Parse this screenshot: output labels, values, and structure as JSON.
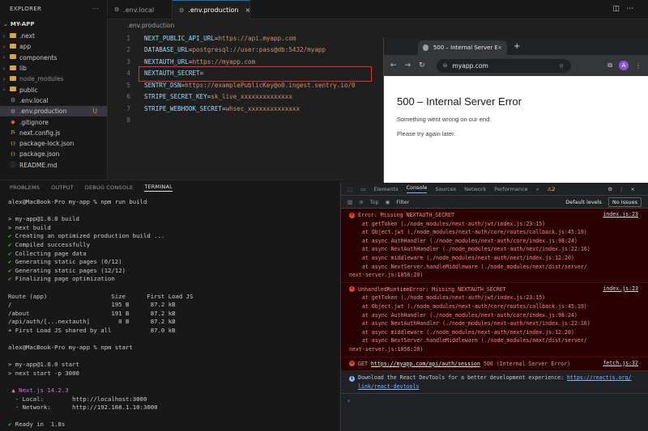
{
  "sidebar": {
    "title": "EXPLORER",
    "more": "···",
    "root": "MY-APP",
    "items": [
      {
        "label": ".next",
        "type": "folder",
        "dim": false,
        "badge": ""
      },
      {
        "label": "app",
        "type": "folder",
        "dim": false,
        "badge": ""
      },
      {
        "label": "components",
        "type": "folder",
        "dim": false,
        "badge": ""
      },
      {
        "label": "lib",
        "type": "folder",
        "dim": false,
        "badge": ""
      },
      {
        "label": "node_modules",
        "type": "folder",
        "dim": true,
        "badge": ""
      },
      {
        "label": "public",
        "type": "folder",
        "dim": false,
        "badge": ""
      },
      {
        "label": ".env.local",
        "type": "env",
        "dim": false,
        "badge": ""
      },
      {
        "label": ".env.production",
        "type": "env",
        "dim": false,
        "badge": "U"
      },
      {
        "label": ".gitignore",
        "type": "git",
        "dim": false,
        "badge": ""
      },
      {
        "label": "next.config.js",
        "type": "js",
        "dim": false,
        "badge": ""
      },
      {
        "label": "package-lock.json",
        "type": "json",
        "dim": false,
        "badge": ""
      },
      {
        "label": "package.json",
        "type": "json",
        "dim": false,
        "badge": ""
      },
      {
        "label": "README.md",
        "type": "md",
        "dim": false,
        "badge": ""
      }
    ]
  },
  "tabs": [
    {
      "label": ".env.local",
      "active": false
    },
    {
      "label": ".env.production",
      "active": true
    }
  ],
  "breadcrumb": ".env.production",
  "editor": {
    "lines": [
      {
        "n": "1",
        "key": "NEXT_PUBLIC_API_URL",
        "val": "https://api.myapp.com"
      },
      {
        "n": "2",
        "key": "DATABASE_URL",
        "val": "postgresql://user:pass@db:5432/myapp"
      },
      {
        "n": "3",
        "key": "NEXTAUTH_URL",
        "val": "https://myapp.com"
      },
      {
        "n": "4",
        "key": "NEXTAUTH_SECRET",
        "val": ""
      },
      {
        "n": "5",
        "key": "SENTRY_DSN",
        "val": "https://examplePublicKey@o0.ingest.sentry.io/0"
      },
      {
        "n": "6",
        "key": "STRIPE_SECRET_KEY",
        "val": "sk_live_xxxxxxxxxxxxxx"
      },
      {
        "n": "7",
        "key": "STRIPE_WEBHOOK_SECRET",
        "val": "whsec_xxxxxxxxxxxxxx"
      },
      {
        "n": "8",
        "key": "",
        "val": ""
      }
    ]
  },
  "browser": {
    "tab_title": "500 – Internal Server Error",
    "url": "myapp.com",
    "avatar": "A",
    "heading": "500 – Internal Server Error",
    "line1": "Something went wrong on our end.",
    "line2": "Please try again later."
  },
  "panel": {
    "tabs": [
      "PROBLEMS",
      "OUTPUT",
      "DEBUG CONSOLE",
      "TERMINAL"
    ],
    "active_tab": "TERMINAL"
  },
  "terminal": {
    "lines": [
      "alex@MacBook-Pro my-app % npm run build",
      "",
      "> my-app@1.0.0 build",
      "> next build",
      "✔ Creating an optimized production build ...",
      "✔ Compiled successfully",
      "✔ Collecting page data",
      "✔ Generating static pages (0/12)",
      "✔ Generating static pages (12/12)",
      "✔ Finalizing page optimization",
      "",
      "Route (app)                  Size      First Load JS",
      "/                            195 B      87.2 kB",
      "/about                       191 B      87.2 kB",
      "/api/auth/[...nextauth]        0 B      87.2 kB",
      "+ First Load JS shared by all           87.0 kB",
      "",
      "alex@MacBook-Pro my-app % npm start",
      "",
      "> my-app@1.0.0 start",
      "> next start -p 3000",
      "",
      " ▲ Next.js 14.2.3",
      "  - Local:        http://localhost:3000",
      "  - Network:      http://192.168.1.10:3000",
      "",
      "✔ Ready in  1.8s"
    ]
  },
  "devtools": {
    "tabs": [
      "Elements",
      "Console",
      "Sources",
      "Network",
      "Performance"
    ],
    "active_tab": "Console",
    "issues_count": "⚠2",
    "context": "Top",
    "filter_placeholder": "Filter",
    "levels": "Default levels",
    "issues": "No Issues",
    "errors": [
      {
        "lines": [
          "Error: Missing NEXTAUTH_SECRET",
          "    at getToken (./node_modules/next-auth/jwt/index.js:23:15)",
          "    at Object.jwt (./node_modules/next-auth/core/routes/callback.js:45:19)",
          "    at async AuthHandler (./node_modules/next-auth/core/index.js:98:24)",
          "    at async NextAuthHandler (./node_modules/next-auth/next/index.js:22:16)",
          "    at async middleware (./node_modules/next-auth/next/index.js:12:20)",
          "    at async NextServer.handleMiddleware (./node_modules/next/dist/server/",
          "next-server.js:1056:20)"
        ],
        "source": "index.js:23"
      },
      {
        "lines": [
          "UnhandledRuntimeError: Missing NEXTAUTH_SECRET",
          "    at getToken (./node_modules/next-auth/jwt/index.js:23:15)",
          "    at Object.jwt (./node_modules/next-auth/core/routes/callback.js:45:19)",
          "    at async AuthHandler (./node_modules/next-auth/core/index.js:98:24)",
          "    at async NextAuthHandler (./node_modules/next-auth/next/index.js:22:16)",
          "    at async middleware (./node_modules/next-auth/next/index.js:12:20)",
          "    at async NextServer.handleMiddleware (./node_modules/next/dist/server/",
          "next-server.js:1056:20)"
        ],
        "source": "index.js:23"
      }
    ],
    "get_error": {
      "method": "GET ",
      "url": "https://myapp.com/api/auth/session",
      "status": " 500 (Internal Server Error)",
      "source": "fetch.js:32"
    },
    "info": {
      "text": "Download the React DevTools for a better development experience: ",
      "link1": "https://reactjs.org/",
      "link2": "link/react-devtools"
    },
    "prompt": "›"
  },
  "colors": {
    "highlight_border": "#e03030",
    "error_bg": "#290000",
    "accent": "#0078d4"
  }
}
